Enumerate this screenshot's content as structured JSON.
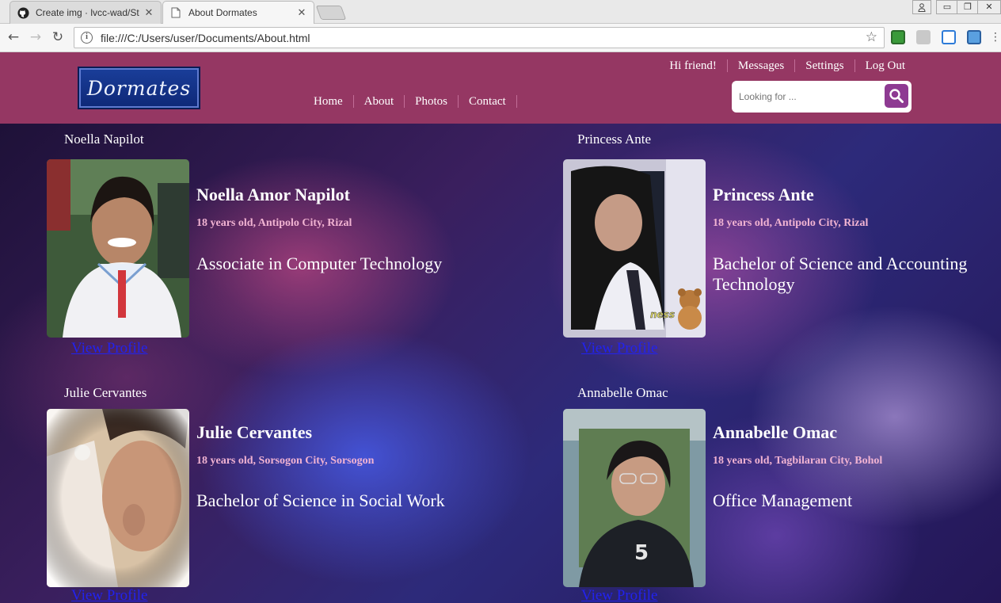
{
  "browser": {
    "tabs": [
      {
        "title": "Create img · lvcc-wad/St"
      },
      {
        "title": "About Dormates"
      }
    ],
    "url": "file:///C:/Users/user/Documents/About.html"
  },
  "header": {
    "logo_text": "Dormates",
    "top_links": [
      "Hi friend!",
      "Messages",
      "Settings",
      "Log Out"
    ],
    "main_nav": [
      "Home",
      "About",
      "Photos",
      "Contact"
    ],
    "search_placeholder": "Looking for ..."
  },
  "profiles": [
    {
      "label": "Noella Napilot",
      "full_name": "Noella Amor Napilot",
      "details": "18 years old, Antipolo City, Rizal",
      "course": "Associate in Computer Technology",
      "link": "View Profile"
    },
    {
      "label": "Princess Ante",
      "full_name": "Princess Ante",
      "details": "18 years old, Antipolo City, Rizal",
      "course": "Bachelor of Science and Accounting Technology",
      "link": "View Profile"
    },
    {
      "label": "Julie Cervantes",
      "full_name": "Julie Cervantes",
      "details": "18 years old, Sorsogon City, Sorsogon",
      "course": "Bachelor of Science in Social Work",
      "link": "View Profile"
    },
    {
      "label": "Annabelle Omac",
      "full_name": "Annabelle Omac",
      "details": "18 years old, Tagbilaran City, Bohol",
      "course": "Office Management",
      "link": "View Profile"
    }
  ],
  "photo_overlay_text": "ness",
  "colors": {
    "header_bg": "#953763",
    "search_button": "#8e3a92",
    "details_text": "#f1b3d2",
    "link": "#2222ee"
  }
}
